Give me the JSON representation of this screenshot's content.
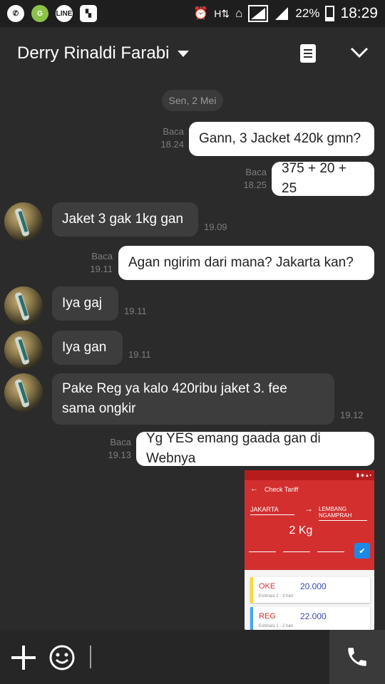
{
  "status_bar": {
    "left_icons": [
      "whatsapp-icon",
      "line-icon",
      "line-icon",
      "bbm-icon"
    ],
    "right_icons": [
      "alarm-icon",
      "h-signal-icon",
      "home-icon",
      "signal-icon",
      "signal-icon",
      "battery-icon"
    ],
    "battery": "22%",
    "time": "18:29"
  },
  "header": {
    "contact_name": "Derry Rinaldi Farabi",
    "icons": [
      "dropdown-caret-icon",
      "notes-icon",
      "chevron-down-icon"
    ]
  },
  "chat": {
    "date_label": "Sen, 2 Mei",
    "messages": [
      {
        "dir": "out",
        "text": "Gann, 3 Jacket 420k gmn?",
        "read": "Baca",
        "time": "18.24"
      },
      {
        "dir": "out",
        "text": "375 + 20 + 25",
        "read": "Baca",
        "time": "18.25"
      },
      {
        "dir": "in",
        "text": "Jaket 3 gak 1kg gan",
        "time": "19.09"
      },
      {
        "dir": "out",
        "text": "Agan ngirim dari mana? Jakarta kan?",
        "read": "Baca",
        "time": "19.11"
      },
      {
        "dir": "in",
        "text": "Iya gaj",
        "time": "19.11"
      },
      {
        "dir": "in",
        "text": "Iya gan",
        "time": "19.11"
      },
      {
        "dir": "in",
        "text_line1": "Pake Reg ya kalo 420ribu jaket 3. fee",
        "text_line2": "sama ongkir",
        "time": "19.12"
      },
      {
        "dir": "out",
        "text": "Yg YES emang gaada gan di Webnya",
        "read": "Baca",
        "time": "19.13"
      }
    ],
    "image_message": {
      "screen_title": "Check Tariff",
      "from": "JAKARTA",
      "to": "LEMBANG NGAMPRAH",
      "weight": "2 Kg",
      "services": [
        {
          "name": "OKE",
          "price": "20.000",
          "duration": "Estimasi 2 - 3 hari",
          "bar_color": "#fdd835"
        },
        {
          "name": "REG",
          "price": "22.000",
          "duration": "Estimasi 1 - 2 hari",
          "bar_color": "#42a5f5"
        }
      ]
    }
  },
  "input_bar": {
    "icons": [
      "plus-icon",
      "smiley-icon",
      "phone-icon"
    ],
    "message_value": ""
  }
}
